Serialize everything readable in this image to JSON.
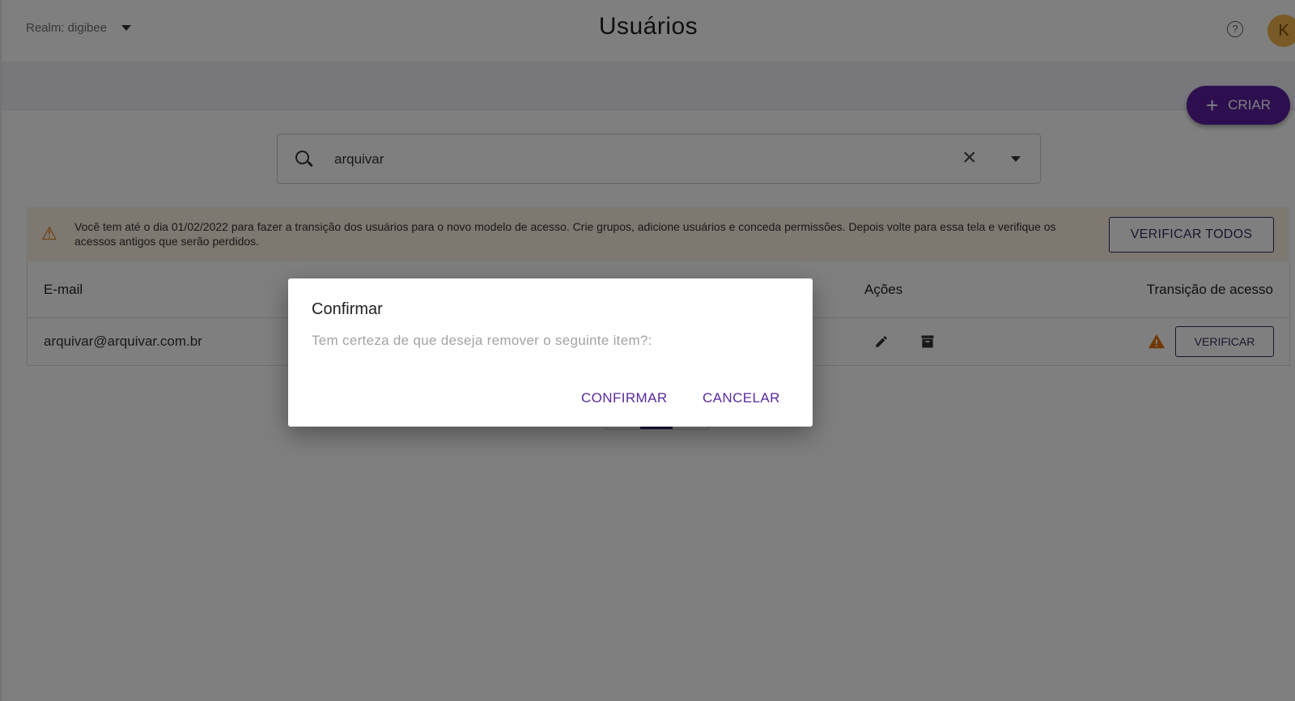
{
  "header": {
    "realm_label": "Realm: digibee",
    "title": "Usuários",
    "help_glyph": "?",
    "avatar_initial": "K"
  },
  "actions": {
    "create_label": "CRIAR"
  },
  "search": {
    "value": "arquivar"
  },
  "warning": {
    "message": "Você tem até o dia 01/02/2022 para fazer a transição dos usuários para o novo modelo de acesso. Crie grupos, adicione usuários e conceda permissões. Depois volte para essa tela e verifique os acessos antigos que serão perdidos.",
    "verify_all_label": "VERIFICAR TODOS"
  },
  "table": {
    "headers": {
      "email": "E-mail",
      "actions": "Ações",
      "transition": "Transição de acesso"
    },
    "rows": [
      {
        "email": "arquivar@arquivar.com.br",
        "verify_label": "VERIFICAR"
      }
    ]
  },
  "dialog": {
    "title": "Confirmar",
    "message": "Tem certeza de que deseja remover o seguinte item?:",
    "confirm_label": "CONFIRMAR",
    "cancel_label": "CANCELAR"
  },
  "colors": {
    "primary": "#5a1ea0",
    "warning_bg": "#fbf0e1",
    "warning_icon": "#d86c00",
    "avatar": "#f2b24b"
  },
  "icons": [
    "caret-down-icon",
    "help-icon",
    "plus-icon",
    "search-icon",
    "close-icon",
    "warning-icon",
    "pencil-icon",
    "archive-icon"
  ]
}
